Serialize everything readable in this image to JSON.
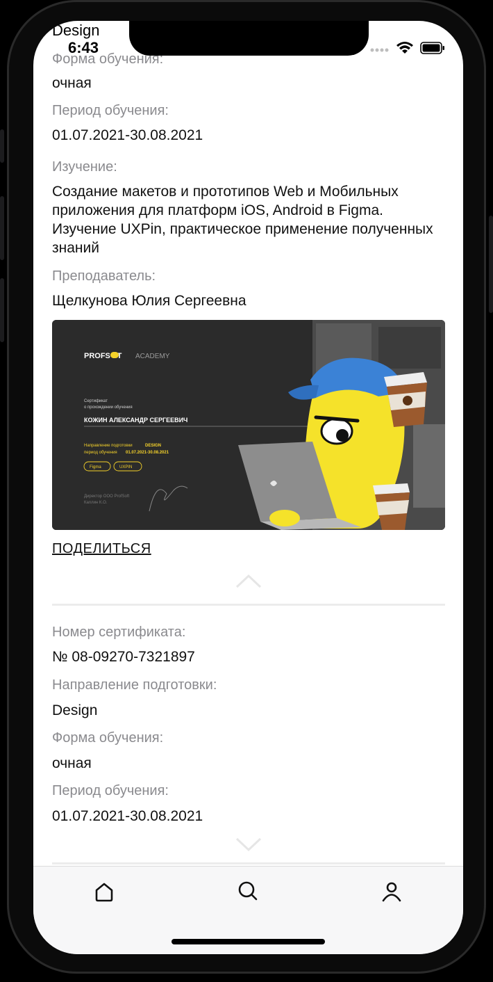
{
  "status": {
    "app_name": "Design",
    "time": "6:43"
  },
  "current": {
    "form_label": "Форма обучения:",
    "form_value": "очная",
    "period_label": "Период обучения:",
    "period_value": "01.07.2021-30.08.2021",
    "study_label": "Изучение:",
    "study_value": "Создание макетов и прототипов Web и Мобильных приложения для платформ iOS, Android в Figma. Изучение UXPin, практическое применение полученных знаний",
    "teacher_label": "Преподаватель:",
    "teacher_value": "Щелкунова Юлия Сергеевна",
    "share_label": "ПОДЕЛИТЬСЯ"
  },
  "certificate_image": {
    "brand": "PROFS FT",
    "brand_suffix": "ACADEMY",
    "caption_line1": "Сертификат",
    "caption_line2": "о прохождении обучения",
    "holder": "КОЖИН АЛЕКСАНДР СЕРГЕЕВИЧ",
    "direction_prefix": "Направление подготовки",
    "direction": "DESIGN",
    "period_prefix": "период обучения",
    "period": "01.07.2021-30.08.2021",
    "tags": [
      "Figma",
      "UXPIN"
    ],
    "director_line1": "Директор ООО ProfSoft",
    "director_line2": "Каплин К.О."
  },
  "next": {
    "number_label": "Номер сертификата:",
    "number_value": "№ 08-09270-7321897",
    "direction_label": "Направление подготовки:",
    "direction_value": "Design",
    "form_label": "Форма обучения:",
    "form_value": "очная",
    "period_label": "Период обучения:",
    "period_value": "01.07.2021-30.08.2021"
  },
  "tabbar": {
    "icons": [
      "home-icon",
      "search-icon",
      "profile-icon"
    ]
  },
  "colors": {
    "accent": "#f5d22a",
    "label_gray": "#8a8a8e",
    "text": "#111111",
    "tabbar_bg": "#f7f7f8"
  }
}
